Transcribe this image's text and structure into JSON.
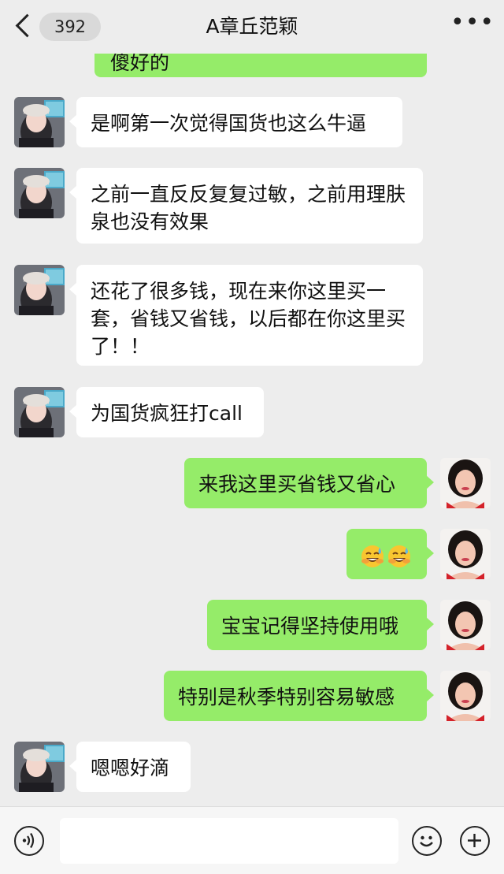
{
  "header": {
    "unread_count": "392",
    "title": "A章丘范颖",
    "more_label": "•••"
  },
  "messages": [
    {
      "side": "out",
      "text": "傻好的"
    },
    {
      "side": "in",
      "text": "是啊第一次觉得国货也这么牛逼"
    },
    {
      "side": "in",
      "text": "之前一直反反复复过敏，之前用理肤泉也没有效果"
    },
    {
      "side": "in",
      "text": "还花了很多钱，现在来你这里买一套，省钱又省钱，以后都在你这里买了！！"
    },
    {
      "side": "in",
      "text": "为国货疯狂打call"
    },
    {
      "side": "out",
      "text": "来我这里买省钱又省心"
    },
    {
      "side": "out",
      "text": "",
      "emoji": [
        "grinning-sweat-emoji",
        "grinning-sweat-emoji"
      ]
    },
    {
      "side": "out",
      "text": "宝宝记得坚持使用哦"
    },
    {
      "side": "out",
      "text": "特别是秋季特别容易敏感"
    },
    {
      "side": "in",
      "text": "嗯嗯好滴"
    }
  ],
  "input_bar": {
    "voice_icon": "voice-icon",
    "emoji_icon": "emoji-icon",
    "plus_icon": "plus-icon",
    "draft": ""
  },
  "colors": {
    "background": "#ededed",
    "outgoing_bubble": "#95ec69",
    "incoming_bubble": "#ffffff"
  }
}
